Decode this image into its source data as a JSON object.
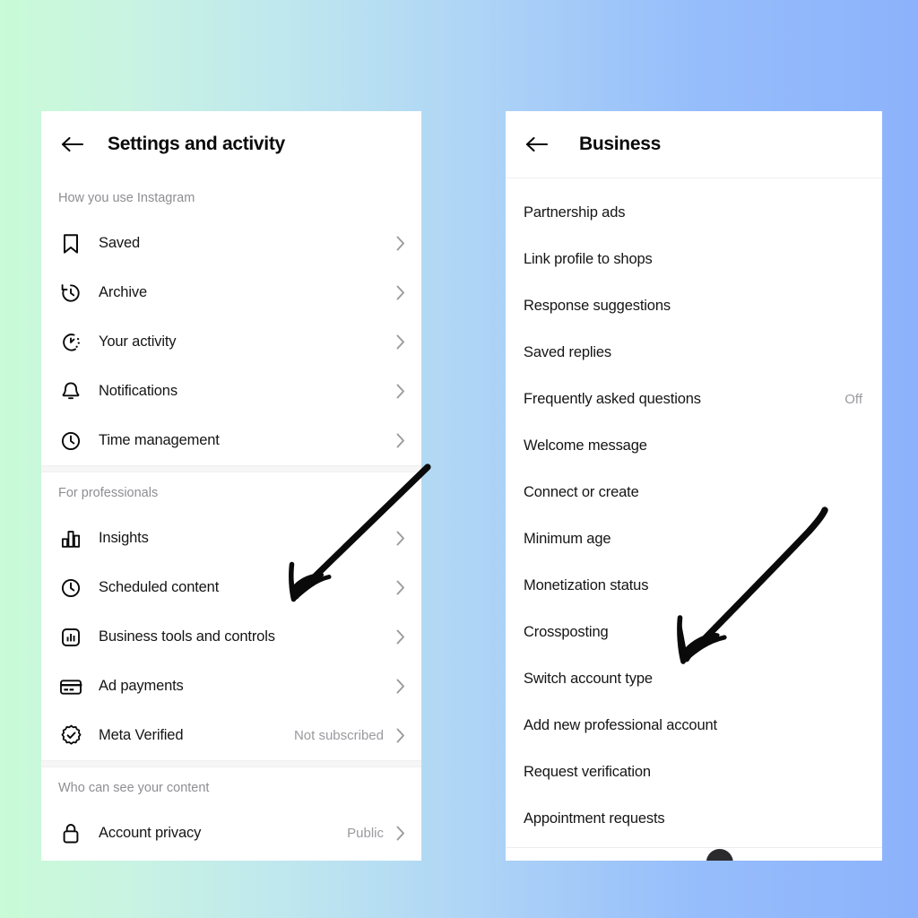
{
  "background": {
    "gradient_from": "#c9fbd7",
    "gradient_to": "#8cb2fb",
    "direction": "left-to-right"
  },
  "left_panel": {
    "back_icon": "back-arrow-icon",
    "title": "Settings and activity",
    "sections": [
      {
        "label": "How you use Instagram",
        "items": [
          {
            "icon": "bookmark-icon",
            "label": "Saved",
            "value": "",
            "chevron": true
          },
          {
            "icon": "archive-clock-icon",
            "label": "Archive",
            "value": "",
            "chevron": true
          },
          {
            "icon": "activity-clock-icon",
            "label": "Your activity",
            "value": "",
            "chevron": true
          },
          {
            "icon": "bell-icon",
            "label": "Notifications",
            "value": "",
            "chevron": true
          },
          {
            "icon": "clock-icon",
            "label": "Time management",
            "value": "",
            "chevron": true
          }
        ]
      },
      {
        "label": "For professionals",
        "items": [
          {
            "icon": "bar-chart-icon",
            "label": "Insights",
            "value": "",
            "chevron": true
          },
          {
            "icon": "clock-icon",
            "label": "Scheduled content",
            "value": "",
            "chevron": true
          },
          {
            "icon": "chart-in-square-icon",
            "label": "Business tools and controls",
            "value": "",
            "chevron": true
          },
          {
            "icon": "credit-card-icon",
            "label": "Ad payments",
            "value": "",
            "chevron": true
          },
          {
            "icon": "verified-badge-icon",
            "label": "Meta Verified",
            "value": "Not subscribed",
            "chevron": true
          }
        ]
      },
      {
        "label": "Who can see your content",
        "items": [
          {
            "icon": "lock-icon",
            "label": "Account privacy",
            "value": "Public",
            "chevron": true
          }
        ]
      }
    ]
  },
  "right_panel": {
    "back_icon": "back-arrow-icon",
    "title": "Business",
    "items": [
      {
        "label": "Partnership ads",
        "value": ""
      },
      {
        "label": "Link profile to shops",
        "value": ""
      },
      {
        "label": "Response suggestions",
        "value": ""
      },
      {
        "label": "Saved replies",
        "value": ""
      },
      {
        "label": "Frequently asked questions",
        "value": "Off"
      },
      {
        "label": "Welcome message",
        "value": ""
      },
      {
        "label": "Connect or create",
        "value": ""
      },
      {
        "label": "Minimum age",
        "value": ""
      },
      {
        "label": "Monetization status",
        "value": ""
      },
      {
        "label": "Crossposting",
        "value": ""
      },
      {
        "label": "Switch account type",
        "value": ""
      },
      {
        "label": "Add new professional account",
        "value": ""
      },
      {
        "label": "Request verification",
        "value": ""
      },
      {
        "label": "Appointment requests",
        "value": ""
      }
    ]
  },
  "annotations": [
    {
      "name": "arrow-pointing-to-business-tools",
      "style": "hand-drawn",
      "color": "#0a0a0a",
      "direction": "down-left"
    },
    {
      "name": "arrow-pointing-to-switch-account-type",
      "style": "hand-drawn",
      "color": "#0a0a0a",
      "direction": "down-left"
    }
  ]
}
